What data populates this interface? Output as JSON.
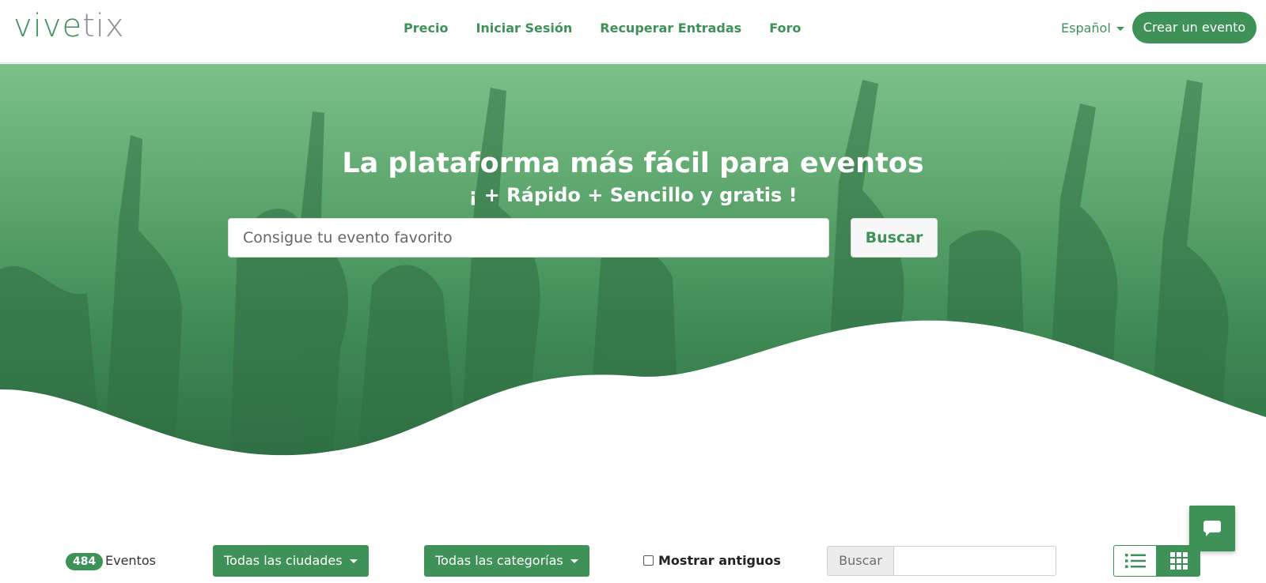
{
  "brand": {
    "logo_part1": "vive",
    "logo_part2": "tix",
    "accent": "#3e9257"
  },
  "nav": {
    "links": [
      "Precio",
      "Iniciar Sesión",
      "Recuperar Entradas",
      "Foro"
    ],
    "language": "Español",
    "create_event": "Crear un evento"
  },
  "hero": {
    "title": "La plataforma más fácil para eventos",
    "subtitle": "¡ + Rápido + Sencillo y gratis !",
    "search_placeholder": "Consigue tu evento favorito",
    "search_button": "Buscar"
  },
  "filters": {
    "event_count": "484",
    "event_count_label": "Eventos",
    "cities": "Todas las ciudades",
    "categories": "Todas las categorías",
    "show_old": "Mostrar antiguos",
    "search_prefix": "Buscar",
    "search_value": ""
  },
  "icons": {
    "list_view": "list-icon",
    "grid_view": "grid-icon",
    "chat": "chat-icon"
  }
}
